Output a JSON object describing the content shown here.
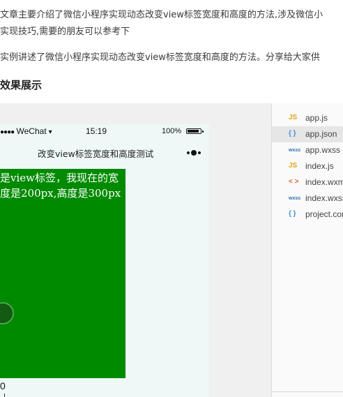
{
  "article": {
    "intro_line1": "文章主要介绍了微信小程序实现动态改变view标签宽度和高度的方法,涉及微信小",
    "intro_line2": "实现技巧,需要的朋友可以参考下",
    "body_line": "实例讲述了微信小程序实现动态改变view标签宽度和高度的方法。分享给大家供",
    "section_heading": "效果展示"
  },
  "phone": {
    "status": {
      "carrier": "WeChat",
      "time": "15:19",
      "battery": "100%"
    },
    "nav_title": "改变view标签宽度和高度测试",
    "green_box": {
      "line1": "是view标签，我现在的宽",
      "line2": "度是200px,高度是300px",
      "color": "#008a00"
    },
    "below_value": "0"
  },
  "file_tree": {
    "files": [
      {
        "icon": "JS",
        "name": "app.js"
      },
      {
        "icon": "{ }",
        "name": "app.json"
      },
      {
        "icon": "wxss",
        "name": "app.wxss"
      },
      {
        "icon": "JS",
        "name": "index.js"
      },
      {
        "icon": "< >",
        "name": "index.wxml"
      },
      {
        "icon": "wxss",
        "name": "index.wxss"
      },
      {
        "icon": "{ }",
        "name": "project.config.json"
      }
    ],
    "selected_index": 1
  }
}
